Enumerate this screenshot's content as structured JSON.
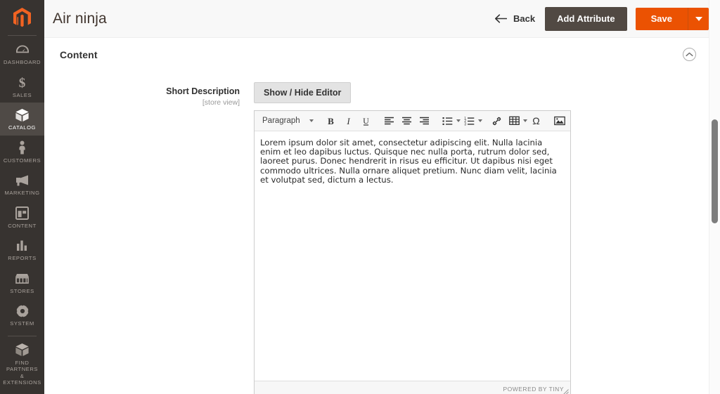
{
  "sidebar": {
    "logo": "magento-logo",
    "items": [
      {
        "label": "DASHBOARD",
        "icon": "dashboard-gauge-icon",
        "active": false
      },
      {
        "label": "SALES",
        "icon": "dollar-sign-icon",
        "active": false
      },
      {
        "label": "CATALOG",
        "icon": "box-icon",
        "active": true
      },
      {
        "label": "CUSTOMERS",
        "icon": "person-icon",
        "active": false
      },
      {
        "label": "MARKETING",
        "icon": "megaphone-icon",
        "active": false
      },
      {
        "label": "CONTENT",
        "icon": "layout-panel-icon",
        "active": false
      },
      {
        "label": "REPORTS",
        "icon": "bar-chart-icon",
        "active": false
      },
      {
        "label": "STORES",
        "icon": "storefront-icon",
        "active": false
      },
      {
        "label": "SYSTEM",
        "icon": "gear-icon",
        "active": false
      }
    ],
    "footer_item": {
      "label": "FIND PARTNERS\n& EXTENSIONS",
      "icon": "box-icon"
    }
  },
  "header": {
    "title": "Air ninja",
    "back_label": "Back",
    "back_icon": "arrow-left-icon",
    "add_attribute_label": "Add Attribute",
    "save_label": "Save",
    "save_caret_icon": "chevron-down-icon",
    "accent_color": "#eb5202",
    "dark_button_color": "#514943"
  },
  "section": {
    "title": "Content",
    "collapse_icon": "chevron-up-circle-icon"
  },
  "field": {
    "label": "Short Description",
    "scope": "[store view]",
    "toggle_editor_label": "Show / Hide Editor"
  },
  "editor": {
    "format_select": "Paragraph",
    "toolbar": [
      {
        "name": "bold-icon",
        "glyph": "B"
      },
      {
        "name": "italic-icon",
        "glyph": "I"
      },
      {
        "name": "underline-icon",
        "glyph": "U"
      },
      {
        "name": "align-left-icon",
        "glyph": ""
      },
      {
        "name": "align-center-icon",
        "glyph": ""
      },
      {
        "name": "align-right-icon",
        "glyph": ""
      },
      {
        "name": "bullet-list-icon",
        "glyph": ""
      },
      {
        "name": "numbered-list-icon",
        "glyph": ""
      },
      {
        "name": "link-icon",
        "glyph": ""
      },
      {
        "name": "table-icon",
        "glyph": ""
      },
      {
        "name": "special-character-icon",
        "glyph": "Ω"
      },
      {
        "name": "insert-image-icon",
        "glyph": ""
      }
    ],
    "content": "Lorem ipsum dolor sit amet, consectetur adipiscing elit. Nulla lacinia enim et leo dapibus luctus. Quisque nec nulla porta, rutrum dolor sed, laoreet purus. Donec hendrerit in risus eu efficitur. Ut dapibus nisi eget commodo ultrices. Nulla ornare aliquet pretium. Nunc diam velit, lacinia et volutpat sed, dictum a lectus.",
    "status_brand": "POWERED BY TINY"
  }
}
